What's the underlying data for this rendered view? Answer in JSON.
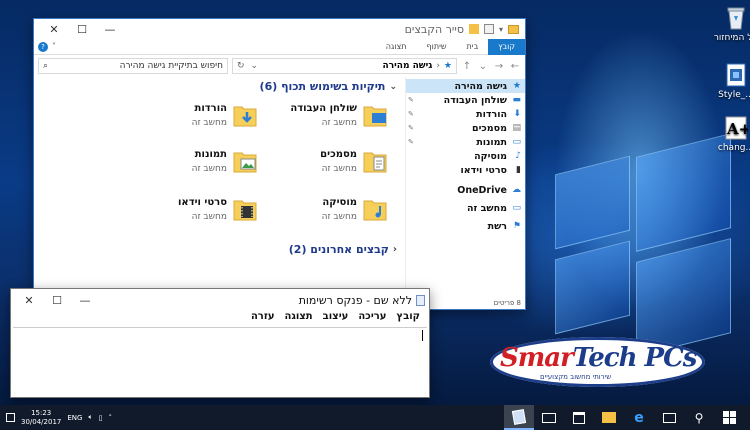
{
  "desktop": {
    "icons": [
      {
        "label": "סל המיחזור",
        "icon": "recycle-bin-icon"
      },
      {
        "label": "Style_...",
        "icon": "document-icon"
      },
      {
        "label": "chang...",
        "icon": "font-file-icon"
      }
    ]
  },
  "explorer": {
    "title": "סייר הקבצים",
    "ribbon_tabs": [
      "קובץ",
      "בית",
      "שיתוף",
      "תצוגה"
    ],
    "address": "גישה מהירה",
    "search_placeholder": "חיפוש בתיקיית גישה מהירה",
    "nav_items": [
      {
        "label": "גישה מהירה",
        "icon": "star-icon",
        "active": true,
        "pinned": false
      },
      {
        "label": "שולחן העבודה",
        "icon": "desktop-icon",
        "pinned": true
      },
      {
        "label": "הורדות",
        "icon": "download-icon",
        "pinned": true
      },
      {
        "label": "מסמכים",
        "icon": "documents-icon",
        "pinned": true
      },
      {
        "label": "תמונות",
        "icon": "pictures-icon",
        "pinned": true
      },
      {
        "label": "מוסיקה",
        "icon": "music-icon",
        "pinned": false
      },
      {
        "label": "סרטי וידאו",
        "icon": "video-icon",
        "pinned": false
      },
      {
        "label": "OneDrive",
        "icon": "onedrive-icon",
        "pinned": false
      },
      {
        "label": "מחשב זה",
        "icon": "computer-icon",
        "pinned": false
      },
      {
        "label": "רשת",
        "icon": "network-icon",
        "pinned": false
      }
    ],
    "frequent_title": "תיקיות בשימוש תכוף (6)",
    "recent_title": "קבצים אחרונים (2)",
    "folders": [
      {
        "name": "שולחן העבודה",
        "sub": "מחשב זה",
        "icon": "desktop-folder-icon"
      },
      {
        "name": "הורדות",
        "sub": "מחשב זה",
        "icon": "downloads-folder-icon"
      },
      {
        "name": "מסמכים",
        "sub": "מחשב זה",
        "icon": "documents-folder-icon"
      },
      {
        "name": "תמונות",
        "sub": "מחשב זה",
        "icon": "pictures-folder-icon"
      },
      {
        "name": "מוסיקה",
        "sub": "מחשב זה",
        "icon": "music-folder-icon"
      },
      {
        "name": "סרטי וידאו",
        "sub": "מחשב זה",
        "icon": "videos-folder-icon"
      }
    ],
    "status": "8 פריטים"
  },
  "notepad": {
    "title": "ללא שם - פנקס רשימות",
    "menu": [
      "קובץ",
      "עריכה",
      "עיצוב",
      "תצוגה",
      "עזרה"
    ]
  },
  "logo": {
    "text_a": "Smar",
    "text_b": "Tech PCs",
    "sub": "שירותי מחשוב מקצועיים"
  },
  "taskbar": {
    "time": "15:23",
    "date": "30/04/2017",
    "lang": "ENG"
  },
  "colors": {
    "accent": "#1979ca",
    "nav_active": "#cce4f7",
    "section_title": "#1e3a8c",
    "logo_red": "#d21f26",
    "logo_blue": "#1c3d8a"
  }
}
